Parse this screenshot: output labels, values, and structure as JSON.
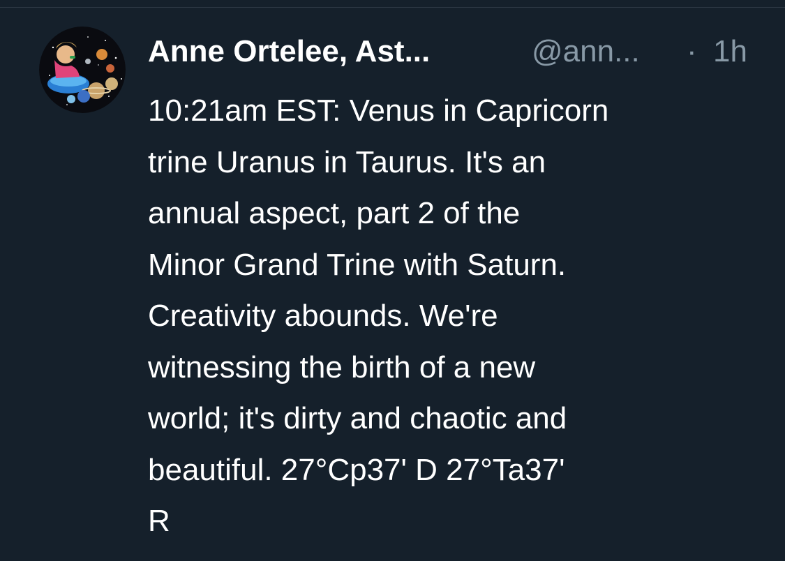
{
  "tweet": {
    "display_name": "Anne Ortelee, Ast...",
    "handle": "@ann...",
    "separator": "·",
    "timestamp": "1h",
    "body_lines": [
      "10:21am EST: Venus in Capricorn",
      "trine Uranus in Taurus. It's an",
      "annual aspect, part 2 of the",
      "Minor Grand Trine with Saturn.",
      "Creativity abounds. We're",
      "witnessing the birth of a new",
      "world; it's dirty and chaotic and",
      "beautiful. 27°Cp37' D 27°Ta37'",
      "R"
    ]
  },
  "colors": {
    "background": "#15202b",
    "text_primary": "#ffffff",
    "text_secondary": "#8899a6"
  },
  "icons": {
    "avatar": "astrology-avatar-icon"
  }
}
